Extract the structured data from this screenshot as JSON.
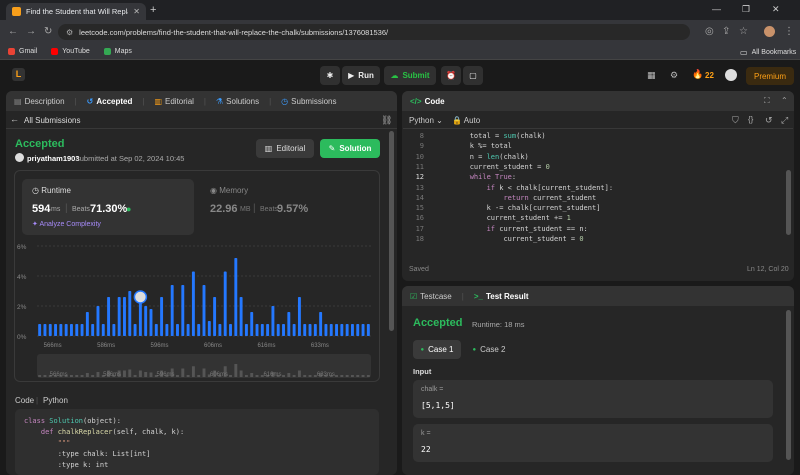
{
  "browser": {
    "tab_title": "Find the Student that Will Replac",
    "url": "leetcode.com/problems/find-the-student-that-will-replace-the-chalk/submissions/1376081536/",
    "bookmarks": [
      "Gmail",
      "YouTube",
      "Maps"
    ],
    "all_bookmarks": "All Bookmarks"
  },
  "toolbar": {
    "run": "Run",
    "submit": "Submit",
    "streak": "22",
    "premium": "Premium"
  },
  "left": {
    "tabs": [
      "Description",
      "Accepted",
      "Editorial",
      "Solutions",
      "Submissions"
    ],
    "all_submissions": "All Submissions",
    "status": "Accepted",
    "user": "priyatham1903",
    "submitted": "submitted at Sep 02, 2024 10:45",
    "editorial_btn": "Editorial",
    "solution_btn": "Solution",
    "runtime_label": "Runtime",
    "runtime_value": "594",
    "runtime_unit": "ms",
    "beats_label": "Beats",
    "runtime_beats": "71.30%",
    "analyze": "Analyze Complexity",
    "memory_label": "Memory",
    "memory_value": "22.96",
    "memory_unit": "MB",
    "memory_beats": "9.57%",
    "code_label": "Code",
    "code_lang": "Python"
  },
  "chart_data": {
    "type": "bar",
    "title": "",
    "ylabel": "",
    "xlabel": "",
    "yticks": [
      "6%",
      "4%",
      "2%",
      "0%"
    ],
    "ylim": [
      0,
      6
    ],
    "xticks": [
      "566ms",
      "586ms",
      "596ms",
      "606ms",
      "616ms",
      "633ms"
    ],
    "values": [
      0.8,
      0.8,
      0.8,
      0.8,
      0.8,
      0.8,
      0.8,
      0.8,
      0.8,
      1.6,
      0.8,
      2.0,
      0.8,
      2.6,
      0.8,
      2.6,
      2.6,
      3.0,
      0.8,
      2.6,
      2.0,
      1.8,
      0.8,
      2.6,
      0.8,
      3.4,
      0.8,
      3.4,
      0.8,
      4.3,
      0.8,
      3.4,
      1.0,
      2.6,
      0.8,
      4.3,
      0.8,
      5.2,
      2.6,
      0.8,
      1.6,
      0.8,
      0.8,
      0.8,
      2.0,
      0.8,
      0.8,
      1.6,
      0.8,
      2.6,
      0.8,
      0.8,
      0.8,
      1.6,
      0.8,
      0.8,
      0.8,
      0.8,
      0.8,
      0.8,
      0.8,
      0.8,
      0.8
    ],
    "highlight_index": 19,
    "grid": true,
    "color": "#2478ff"
  },
  "left_code": [
    [
      "class ",
      "Solution",
      "(object):"
    ],
    [
      "    def ",
      "chalkReplacer",
      "(self, chalk, k):"
    ],
    [
      "        \"\"\"",
      "",
      ""
    ],
    [
      "        :type chalk: List[int]",
      "",
      ""
    ],
    [
      "        :type k: int",
      "",
      ""
    ]
  ],
  "editor": {
    "title": "Code",
    "lang": "Python",
    "auto": "Auto",
    "saved": "Saved",
    "position": "Ln 12, Col 20",
    "line_numbers": [
      "8",
      "9",
      "10",
      "11",
      "12",
      "13",
      "14",
      "15",
      "16",
      "17",
      "18"
    ],
    "lines": [
      "        total = sum(chalk)",
      "        k %= total",
      "        n = len(chalk)",
      "        current_student = 0",
      "        while True:",
      "            if k < chalk[current_student]:",
      "                return current_student",
      "            k -= chalk[current_student]",
      "            current_student += 1",
      "            if current_student == n:",
      "                current_student = 0"
    ]
  },
  "testpanel": {
    "tab_testcase": "Testcase",
    "tab_result": "Test Result",
    "status": "Accepted",
    "runtime": "Runtime: 18 ms",
    "case1": "Case 1",
    "case2": "Case 2",
    "input_label": "Input",
    "chalk_label": "chalk =",
    "chalk_value": "[5,1,5]",
    "k_label": "k =",
    "k_value": "22"
  }
}
